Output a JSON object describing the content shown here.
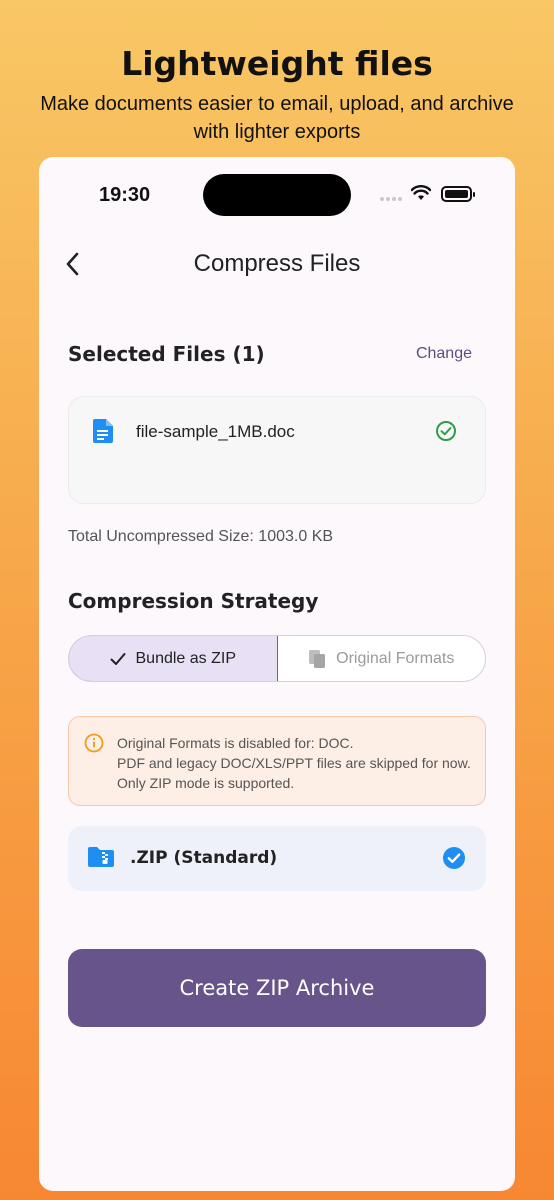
{
  "promo": {
    "title": "Lightweight files",
    "subtitle": "Make documents easier to email, upload, and archive with lighter exports"
  },
  "status_bar": {
    "time": "19:30"
  },
  "nav": {
    "title": "Compress Files",
    "back_icon": "chevron-left-icon"
  },
  "selected_files": {
    "title": "Selected Files (1)",
    "change_label": "Change",
    "files": [
      {
        "name": "file-sample_1MB.doc",
        "icon": "document-icon",
        "status_icon": "check-circle-icon"
      }
    ],
    "total_size": "Total Uncompressed Size: 1003.0 KB"
  },
  "strategy": {
    "title": "Compression Strategy",
    "options": [
      {
        "label": "Bundle as ZIP",
        "icon": "check-icon",
        "selected": true
      },
      {
        "label": "Original Formats",
        "icon": "copy-icon",
        "selected": false
      }
    ]
  },
  "warning": {
    "icon": "info-icon",
    "line1": "Original Formats is disabled for: DOC.",
    "line2": "PDF and legacy DOC/XLS/PPT files are skipped for now. Only ZIP mode is supported."
  },
  "zip_option": {
    "label": ".ZIP (Standard)",
    "icon": "zip-folder-icon",
    "selected": true
  },
  "cta": {
    "label": "Create ZIP Archive"
  },
  "colors": {
    "accent": "#66548b",
    "success": "#2e9d4a",
    "link": "#5b4e85",
    "check_blue": "#1e8ef2",
    "warning_orange": "#f29a1b"
  }
}
